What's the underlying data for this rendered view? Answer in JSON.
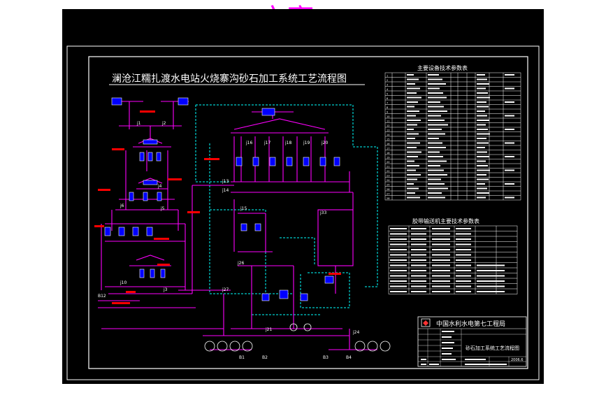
{
  "heading": "方案二",
  "drawing_title": "澜沧江糯扎渡水电站火烧寨沟砂石加工系统工艺流程图",
  "table1": {
    "title": "主要设备技术参数表",
    "row_numbers": [
      "1",
      "2",
      "3",
      "4",
      "5",
      "6",
      "7",
      "8",
      "9",
      "10",
      "11",
      "12",
      "13",
      "14",
      "15",
      "16",
      "17",
      "18",
      "19",
      "20",
      "21",
      "22",
      "23",
      "24",
      "25",
      "26",
      "27",
      "28",
      "29",
      "30",
      "31",
      "32",
      "33",
      "34",
      "35"
    ]
  },
  "table2": {
    "title": "胶带输送机主要技术参数表"
  },
  "title_block": {
    "company": "中国水利水电第七工程局",
    "drawing_name": "砂石加工系统工艺流程图",
    "date": "2006.6"
  },
  "labels": {
    "j1": "j1",
    "j2": "j2",
    "j3": "j3",
    "j4": "j4",
    "j5": "j5",
    "j6": "j6",
    "j10": "j10",
    "j13": "j13",
    "j14": "j14",
    "j15": "j15",
    "j16": "j16",
    "j17": "j17",
    "j18": "j18",
    "j19": "j19",
    "j20": "j20",
    "j21": "j21",
    "j24": "j24",
    "j26": "j26",
    "j27": "j27",
    "j33": "j33",
    "b1": "B1",
    "b2": "B2",
    "b3": "B3",
    "b4": "B4",
    "b12": "B12"
  },
  "colors": {
    "background": "#000000",
    "frame": "#ffffff",
    "heading": "#ff00ff",
    "process_line": "#ff00ff",
    "water_line": "#00ffff",
    "equipment": "#0000ff",
    "annotation": "#ff0000",
    "table_line": "#ffffff"
  }
}
